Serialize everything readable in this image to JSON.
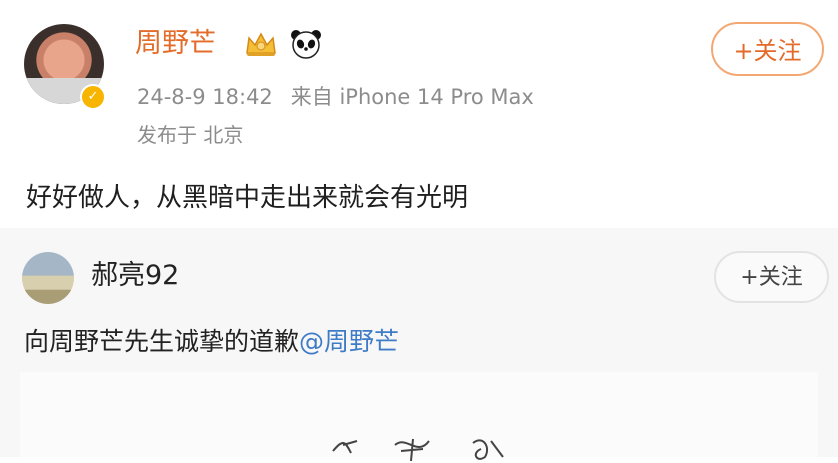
{
  "post": {
    "username": "周野芒",
    "timestamp": "24-8-9 18:42",
    "source": "来自 iPhone 14 Pro Max",
    "location": "发布于 北京",
    "follow_label": "+关注",
    "text": "好好做人，从黑暗中走出来就会有光明"
  },
  "repost": {
    "username": "郝亮92",
    "follow_label": "+关注",
    "text_prefix": "向周野芒先生诚挚的道歉",
    "mention": "@周野芒"
  },
  "colors": {
    "accent": "#e36a2b",
    "mention": "#3f7cc7",
    "meta": "#8c8c8c"
  },
  "icons": [
    "verified-badge-icon",
    "vip-crown-icon",
    "panda-icon"
  ]
}
